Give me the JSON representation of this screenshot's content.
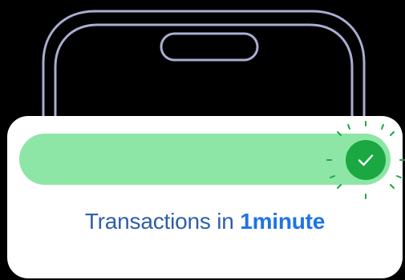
{
  "colors": {
    "background": "#000000",
    "phone_outline": "#a9aed2",
    "card_background": "#ffffff",
    "progress_fill": "#8de6a5",
    "success_green": "#1ba843",
    "caption_text": "#2f5ea8",
    "caption_emphasis": "#1f73e6"
  },
  "progress": {
    "percent_complete": 100,
    "status_icon": "check-icon"
  },
  "caption": {
    "prefix": "Transactions in ",
    "emphasis": "1minute"
  },
  "icons": {
    "phone": "phone-outline-icon",
    "notch": "phone-notch-icon",
    "sparkles": "sparkle-rays-icon"
  }
}
